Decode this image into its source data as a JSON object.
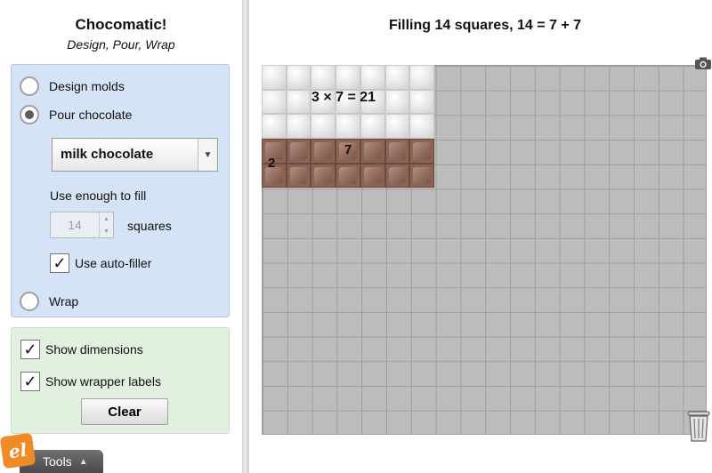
{
  "app": {
    "title": "Chocomatic!",
    "subtitle": "Design, Pour, Wrap"
  },
  "modes": [
    {
      "label": "Design molds",
      "selected": false
    },
    {
      "label": "Pour chocolate",
      "selected": true
    },
    {
      "label": "Wrap",
      "selected": false
    }
  ],
  "pour": {
    "chocolate_type": "milk chocolate",
    "fill_label": "Use enough to fill",
    "squares_value": "14",
    "squares_label": "squares",
    "auto_filler_label": "Use auto-filler",
    "auto_filler_checked": true
  },
  "display_options": {
    "show_dimensions_label": "Show dimensions",
    "show_dimensions_checked": true,
    "show_wrapper_labels_label": "Show wrapper labels",
    "show_wrapper_labels_checked": true,
    "clear_label": "Clear"
  },
  "tools": {
    "logo_text": "el",
    "tab_label": "Tools"
  },
  "workspace": {
    "heading": "Filling 14 squares, 14 = 7 + 7",
    "mold_label": "3 × 7 = 21",
    "chocolate_width_label": "7",
    "chocolate_height_label": "2",
    "mold": {
      "rows": 3,
      "cols": 7
    },
    "chocolate": {
      "rows": 2,
      "cols": 7
    }
  },
  "colors": {
    "panel_blue": "#d4e3f5",
    "panel_green": "#e2f1df",
    "grid_gray": "#bdbdbd",
    "chocolate": "#8c6456",
    "logo_orange": "#f08a24"
  }
}
